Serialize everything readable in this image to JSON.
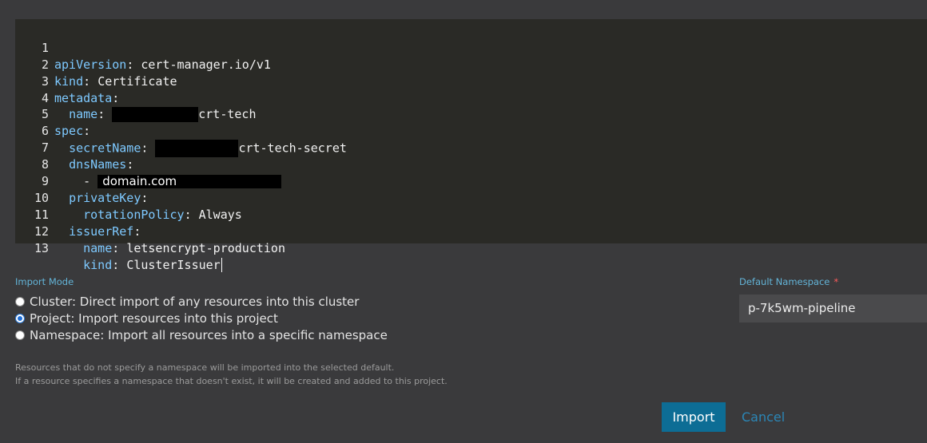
{
  "editor": {
    "lines": [
      {
        "num": "1",
        "key": "apiVersion",
        "sep": ": ",
        "val": "cert-manager.io/v1"
      },
      {
        "num": "2",
        "key": "kind",
        "sep": ": ",
        "val": "Certificate"
      },
      {
        "num": "3",
        "key": "metadata",
        "sep": ":",
        "val": ""
      },
      {
        "num": "4",
        "indent": "  ",
        "key": "name",
        "sep": ": ",
        "val": "crt-tech"
      },
      {
        "num": "5",
        "key": "spec",
        "sep": ":",
        "val": ""
      },
      {
        "num": "6",
        "indent": "  ",
        "key": "secretName",
        "sep": ": ",
        "val": "crt-tech-secret"
      },
      {
        "num": "7",
        "indent": "  ",
        "key": "dnsNames",
        "sep": ":",
        "val": ""
      },
      {
        "num": "8",
        "indent": "    ",
        "key": "",
        "sep": "- ",
        "val": "domain.com"
      },
      {
        "num": "9",
        "indent": "  ",
        "key": "privateKey",
        "sep": ":",
        "val": ""
      },
      {
        "num": "10",
        "indent": "    ",
        "key": "rotationPolicy",
        "sep": ": ",
        "val": "Always"
      },
      {
        "num": "11",
        "indent": "  ",
        "key": "issuerRef",
        "sep": ":",
        "val": ""
      },
      {
        "num": "12",
        "indent": "    ",
        "key": "name",
        "sep": ": ",
        "val": "letsencrypt-production"
      },
      {
        "num": "13",
        "indent": "    ",
        "key": "kind",
        "sep": ": ",
        "val": "ClusterIssuer"
      }
    ]
  },
  "import_mode": {
    "label": "Import Mode",
    "options": [
      {
        "label": "Cluster: Direct import of any resources into this cluster",
        "checked": false
      },
      {
        "label": "Project: Import resources into this project",
        "checked": true
      },
      {
        "label": "Namespace: Import all resources into a specific namespace",
        "checked": false
      }
    ]
  },
  "help": {
    "line1": "Resources that do not specify a namespace will be imported into the selected default.",
    "line2": "If a resource specifies a namespace that doesn't exist, it will be created and added to this project."
  },
  "namespace": {
    "label": "Default Namespace",
    "required_mark": "*",
    "value": "p-7k5wm-pipeline"
  },
  "actions": {
    "import_label": "Import",
    "cancel_label": "Cancel"
  },
  "colors": {
    "yaml_key": "#7ec9ff",
    "accent": "#0d6d95",
    "link": "#2b86b6",
    "label": "#63b4d8",
    "required": "#ff5c5c"
  }
}
